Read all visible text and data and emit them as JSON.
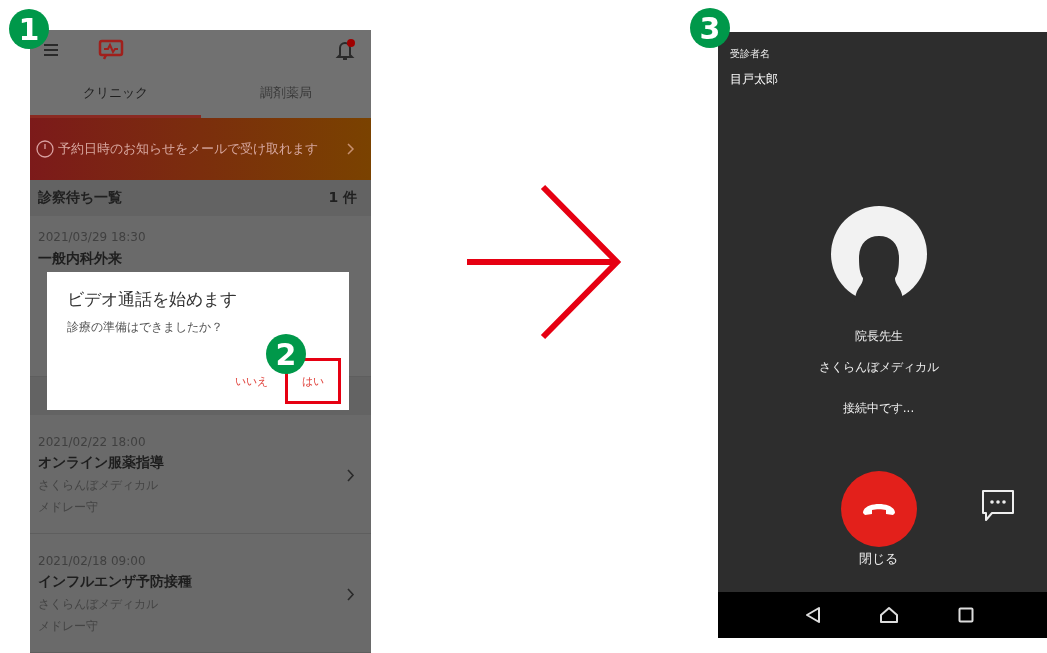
{
  "badges": [
    {
      "number": "1"
    },
    {
      "number": "2"
    },
    {
      "number": "3"
    }
  ],
  "clinic_screen": {
    "notification_unread": true,
    "tabs": [
      {
        "label": "クリニック",
        "selected": true
      },
      {
        "label": "調剤薬局",
        "selected": false
      }
    ],
    "banner": {
      "text": "予約日時のお知らせをメールで受け取れます"
    },
    "waiting_list": {
      "title": "診察待ち一覧",
      "count": "1 件",
      "appointments": [
        {
          "datetime": "2021/03/29 18:30",
          "title": "一般内科外来"
        }
      ]
    },
    "past_appointments": [
      {
        "datetime": "2021/02/22 18:00",
        "title": "オンライン服薬指導",
        "clinic": "さくらんぼメディカル",
        "doctor": "メドレー守"
      },
      {
        "datetime": "2021/02/18 09:00",
        "title": "インフルエンザ予防接種",
        "clinic": "さくらんぼメディカル",
        "doctor": "メドレー守"
      }
    ],
    "dialog": {
      "title": "ビデオ通話を始めます",
      "message": "診療の準備はできましたか？",
      "buttons": [
        {
          "label": "いいえ",
          "highlighted": false
        },
        {
          "label": "はい",
          "highlighted": true
        }
      ]
    }
  },
  "call_screen": {
    "patient_label": "受診者名",
    "patient_name": "目戸太郎",
    "caller_name": "院長先生",
    "clinic": "さくらんぼメディカル",
    "status": "接続中です...",
    "end_call_label": "閉じる"
  }
}
